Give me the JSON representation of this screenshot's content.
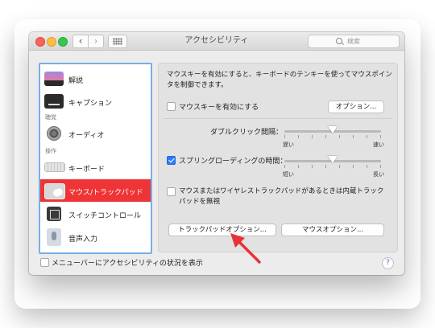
{
  "window": {
    "title": "アクセシビリティ"
  },
  "toolbar": {
    "back": "‹",
    "forward": "›",
    "search_placeholder": "検索"
  },
  "sidebar": {
    "items": [
      {
        "label": "解説",
        "icon": "description-icon"
      },
      {
        "label": "キャプション",
        "icon": "captions-icon"
      },
      {
        "label": "オーディオ",
        "icon": "speaker-icon"
      },
      {
        "label": "キーボード",
        "icon": "keyboard-icon"
      },
      {
        "label": "マウス/トラックパッド",
        "icon": "mouse-trackpad-icon",
        "selected": true
      },
      {
        "label": "スイッチコントロール",
        "icon": "switch-control-icon"
      },
      {
        "label": "音声入力",
        "icon": "microphone-icon"
      }
    ],
    "categories": {
      "hearing": "聴覚",
      "interaction": "操作"
    },
    "selected_color": "#ee3436"
  },
  "main": {
    "description": "マウスキーを有効にすると、キーボードのテンキーを使ってマウスポインタを制御できます。",
    "mouse_keys_label": "マウスキーを有効にする",
    "mouse_keys_checked": false,
    "options_button": "オプション...",
    "double_click_label": "ダブルクリック間隔：",
    "double_click_value": 0.5,
    "slow": "遅い",
    "fast": "速い",
    "spring_loading_label": "スプリングローディングの時間：",
    "spring_loading_checked": true,
    "spring_loading_value": 0.5,
    "short": "短い",
    "long": "長い",
    "ignore_builtin_label": "マウスまたはワイヤレストラックパッドがあるときは内蔵トラックパッドを無視",
    "ignore_builtin_checked": false,
    "trackpad_options_button": "トラックパッドオプション...",
    "mouse_options_button": "マウスオプション..."
  },
  "footer": {
    "menubar_status_label": "メニューバーにアクセシビリティの状況を表示",
    "menubar_status_checked": false,
    "help": "?"
  },
  "colors": {
    "accent": "#2d7cf6",
    "arrow": "#e8323a"
  }
}
